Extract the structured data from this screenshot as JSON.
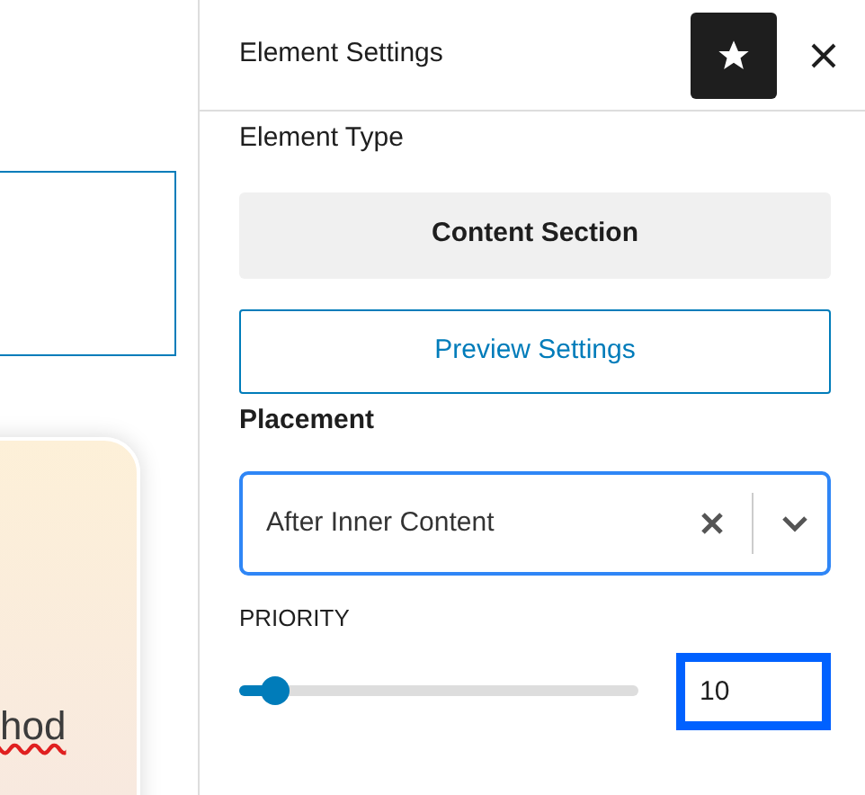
{
  "canvas": {
    "card_text": "hod"
  },
  "panel": {
    "title": "Element Settings",
    "pinned": true,
    "element_type": {
      "label": "Element Type",
      "value": "Content Section"
    },
    "preview_button": "Preview Settings",
    "placement": {
      "label": "Placement",
      "value": "After Inner Content"
    },
    "priority": {
      "label": "PRIORITY",
      "level": 0.09,
      "value": "10"
    }
  }
}
